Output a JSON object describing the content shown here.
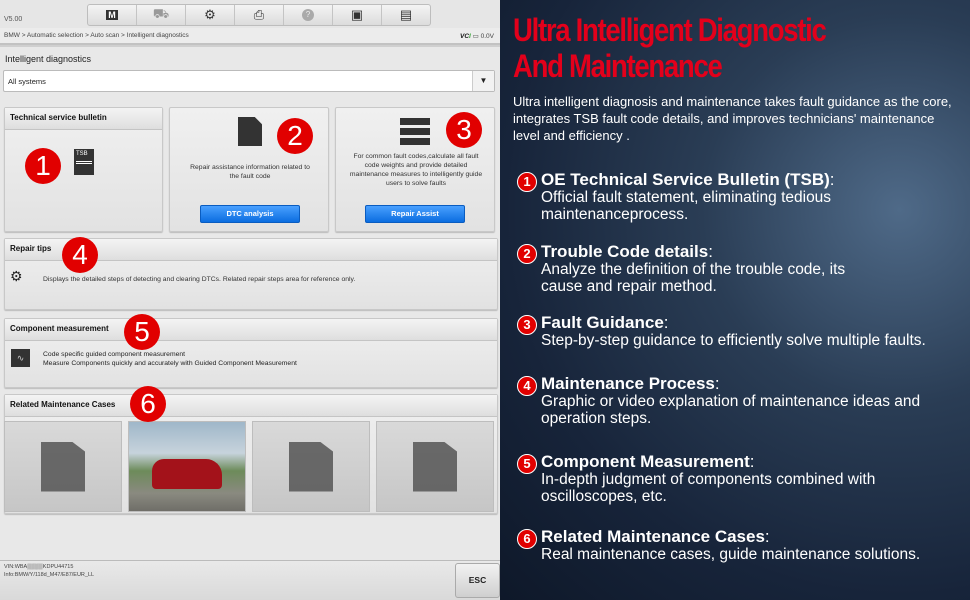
{
  "app": {
    "version": "V5.00",
    "breadcrumb": "BMW > Automatic selection > Auto scan > Intelligent diagnostics",
    "vci_label": "VC",
    "vci_suffix": "I",
    "voltage": "0.0V"
  },
  "toolbar": [
    {
      "icon": "home-icon",
      "glyph": "M"
    },
    {
      "icon": "vehicle-lift-icon",
      "glyph": "⛟"
    },
    {
      "icon": "gear-icon",
      "glyph": "⚙"
    },
    {
      "icon": "printer-icon",
      "glyph": "⎙"
    },
    {
      "icon": "help-icon",
      "glyph": "?"
    },
    {
      "icon": "save-icon",
      "glyph": "▣"
    },
    {
      "icon": "chat-icon",
      "glyph": "▤"
    }
  ],
  "main": {
    "title": "Intelligent diagnostics",
    "dropdown_value": "All systems",
    "tsb": {
      "title": "Technical service bulletin",
      "icon_label": "TSB"
    },
    "dtc": {
      "desc": "Repair assistance information related to the fault code",
      "button": "DTC analysis"
    },
    "assist": {
      "desc": "For common fault codes,calculate all fault code weights and provide detailed maintenance measures to intelligently guide users to solve faults",
      "button": "Repair Assist"
    },
    "repair_tips": {
      "title": "Repair tips",
      "desc": "Displays the detailed steps of detecting and clearing DTCs. Related repair steps area for reference only."
    },
    "component": {
      "title": "Component measurement",
      "line1": "Code specific guided component measurement",
      "line2": "Measure Components quickly and accurately with Guided Component Measurement"
    },
    "cases": {
      "title": "Related Maintenance Cases"
    },
    "markers": [
      "1",
      "2",
      "3",
      "4",
      "5",
      "6"
    ]
  },
  "footer": {
    "vin": "VIN:WBA▒▒▒▒KDPU44715",
    "info": "Info:BMW/Y/118d_M47/E87/EUR_LL",
    "esc": "ESC"
  },
  "promo": {
    "title_line1": "Ultra Intelligent Diagnostic",
    "title_line2": "And Maintenance",
    "desc": "Ultra intelligent diagnosis and maintenance takes fault guidance as the core, integrates TSB fault code details, and improves technicians' maintenance level and efficiency .",
    "items": [
      {
        "num": "1",
        "title": "OE Technical Service Bulletin (TSB)",
        "desc": "Official fault  statement, eliminating tedious maintenanceprocess."
      },
      {
        "num": "2",
        "title": "Trouble Code details",
        "desc": "Analyze the definition of the trouble code, its cause and repair method."
      },
      {
        "num": "3",
        "title": "Fault Guidance",
        "desc": "Step-by-step guidance to efficiently solve multiple faults."
      },
      {
        "num": "4",
        "title": "Maintenance Process",
        "desc": "Graphic or video explanation of maintenance ideas and operation steps."
      },
      {
        "num": "5",
        "title": "Component Measurement",
        "desc": "In-depth judgment of components combined with oscilloscopes, etc."
      },
      {
        "num": "6",
        "title": "Related Maintenance Cases",
        "desc": "Real maintenance cases, guide maintenance solutions."
      }
    ]
  },
  "colors": {
    "accent_red": "#e10000",
    "button_blue": "#0b6de0",
    "promo_bg": "#17243a"
  }
}
